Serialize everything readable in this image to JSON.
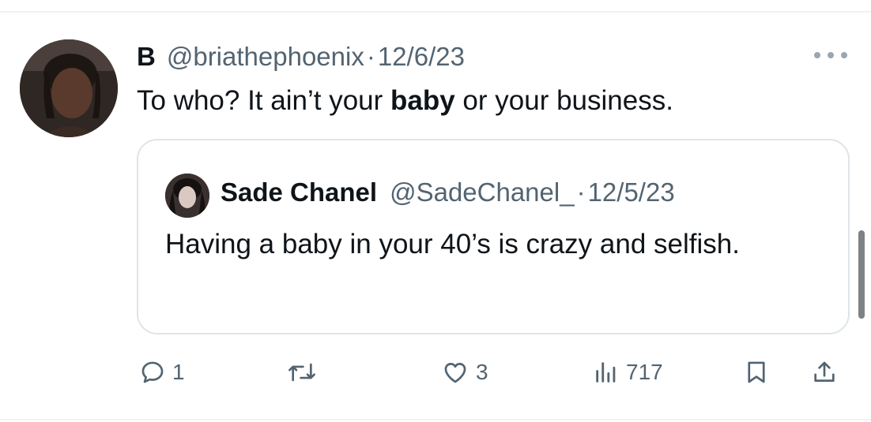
{
  "tweet": {
    "author_name": "B",
    "handle": "@briathephoenix",
    "separator": "·",
    "date": "12/6/23",
    "text_before": "To who? It ain’t your ",
    "text_bold": "baby",
    "text_after": " or your business."
  },
  "quoted_tweet": {
    "author_name": "Sade Chanel",
    "handle": "@SadeChanel_",
    "separator": "·",
    "date": "12/5/23",
    "text": "Having a baby in your 40’s is crazy and selfish."
  },
  "actions": {
    "replies": "1",
    "likes": "3",
    "views": "717"
  },
  "icons": [
    "more-icon",
    "reply-icon",
    "retweet-icon",
    "like-icon",
    "views-icon",
    "bookmark-icon",
    "share-icon"
  ],
  "colors": {
    "text": "#0f1419",
    "secondary": "#536471",
    "border": "#dfe4e8"
  }
}
